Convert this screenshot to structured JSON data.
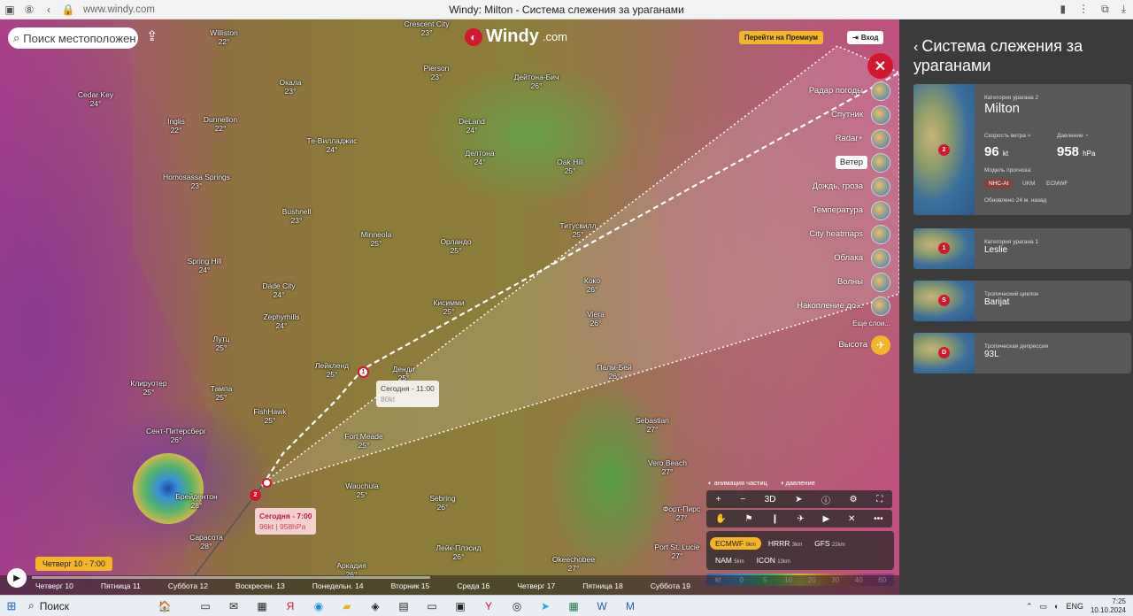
{
  "browser": {
    "url": "www.windy.com",
    "title": "Windy: Milton - Система слежения за ураганами"
  },
  "map": {
    "search_placeholder": "Поиск местоположен",
    "logo": "Windy",
    "logo_tld": ".com",
    "premium_label": "Перейти на Премиум",
    "login_label": "Вход",
    "cities": [
      {
        "name": "Williston",
        "temp": "22°"
      },
      {
        "name": "Crescent City",
        "temp": "23°"
      },
      {
        "name": "Cedar Key",
        "temp": "24°"
      },
      {
        "name": "Окала",
        "temp": "23°"
      },
      {
        "name": "Pierson",
        "temp": "23°"
      },
      {
        "name": "Дейтона-Бич",
        "temp": "26°"
      },
      {
        "name": "Inglis",
        "temp": "22°"
      },
      {
        "name": "Dunnellon",
        "temp": "22°"
      },
      {
        "name": "DeLand",
        "temp": "24°"
      },
      {
        "name": "Те-Вилладжис",
        "temp": "24°"
      },
      {
        "name": "Делтона",
        "temp": "24°"
      },
      {
        "name": "Oak Hill",
        "temp": "25°"
      },
      {
        "name": "Homosassa Springs",
        "temp": "23°"
      },
      {
        "name": "Bushnell",
        "temp": "23°"
      },
      {
        "name": "Титусвилл",
        "temp": "25°"
      },
      {
        "name": "Minneola",
        "temp": "25°"
      },
      {
        "name": "Орландо",
        "temp": "25°"
      },
      {
        "name": "Spring Hill",
        "temp": "24°"
      },
      {
        "name": "Dade City",
        "temp": "24°"
      },
      {
        "name": "Коко",
        "temp": "26°"
      },
      {
        "name": "Кисимми",
        "temp": "25°"
      },
      {
        "name": "Viera",
        "temp": "26°"
      },
      {
        "name": "Zephyrhills",
        "temp": "24°"
      },
      {
        "name": "Лутц",
        "temp": "25°"
      },
      {
        "name": "Лейкленд",
        "temp": "25°"
      },
      {
        "name": "Денди",
        "temp": "25°"
      },
      {
        "name": "Палм-Бей",
        "temp": "26°"
      },
      {
        "name": "Клируотер",
        "temp": "25°"
      },
      {
        "name": "Тампа",
        "temp": "25°"
      },
      {
        "name": "FishHawk",
        "temp": "25°"
      },
      {
        "name": "Sebastian",
        "temp": "27°"
      },
      {
        "name": "Сент-Питерсберг",
        "temp": "26°"
      },
      {
        "name": "Fort Meade",
        "temp": "25°"
      },
      {
        "name": "Vero Beach",
        "temp": "27°"
      },
      {
        "name": "Брейдентон",
        "temp": "28°"
      },
      {
        "name": "Wauchula",
        "temp": "25°"
      },
      {
        "name": "Sebring",
        "temp": "26°"
      },
      {
        "name": "Форт-Пирс",
        "temp": "27°"
      },
      {
        "name": "Сарасота",
        "temp": "28°"
      },
      {
        "name": "Лейк-Плэсид",
        "temp": "26°"
      },
      {
        "name": "Port St. Lucie",
        "temp": "27°"
      },
      {
        "name": "Аркадия",
        "temp": "26°"
      },
      {
        "name": "Okeechobee",
        "temp": "27°"
      }
    ],
    "forecast_point": {
      "time": "Сегодня - 11:00",
      "value": "80kt",
      "pin": "1"
    },
    "current_point": {
      "time": "Сегодня - 7:00",
      "value": "96kt | 958hPa",
      "pin": "2"
    },
    "layers": [
      {
        "label": "Радар погоды",
        "icon": "radar-icon"
      },
      {
        "label": "Спутник",
        "icon": "satellite-icon"
      },
      {
        "label": "Radar+",
        "icon": "radar-plus-icon"
      },
      {
        "label": "Ветер",
        "icon": "wind-icon",
        "active": true
      },
      {
        "label": "Дождь, гроза",
        "icon": "rain-icon"
      },
      {
        "label": "Температура",
        "icon": "temperature-icon"
      },
      {
        "label": "City heatmaps",
        "icon": "heatmap-icon"
      },
      {
        "label": "Облака",
        "icon": "clouds-icon"
      },
      {
        "label": "Волны",
        "icon": "waves-icon"
      },
      {
        "label": "Накопление до...",
        "icon": "accumulation-icon"
      }
    ],
    "more_layers": "Еще слои...",
    "altitude_label": "Высота",
    "toggle_particles": "анимация частиц",
    "toggle_pressure": "давление",
    "tool_3d": "3D",
    "models": [
      {
        "name": "ECMWF",
        "res": "9km",
        "active": true
      },
      {
        "name": "HRRR",
        "res": "3km"
      },
      {
        "name": "GFS",
        "res": "22km"
      },
      {
        "name": "NAM",
        "res": "5km"
      },
      {
        "name": "ICON",
        "res": "13km"
      }
    ],
    "scale": [
      "kt",
      "0",
      "5",
      "10",
      "20",
      "30",
      "40",
      "60"
    ],
    "current_time": "Четверг 10 - 7:00",
    "days": [
      "Четверг 10",
      "Пятница 11",
      "Суббота 12",
      "Воскресен. 13",
      "Понедельн. 14",
      "Вторник 15",
      "Среда 16",
      "Четверг 17",
      "Пятница 18",
      "Суббота 19"
    ]
  },
  "panel": {
    "title": "Система слежения за ураганами",
    "main_card": {
      "category": "Категория урагана 2",
      "name": "Milton",
      "wind_label": "Скорость ветра",
      "wind_value": "96",
      "wind_unit": "kt",
      "pressure_label": "Давление",
      "pressure_value": "958",
      "pressure_unit": "hPa",
      "model_label": "Модель прогноза:",
      "models": [
        "NHC-At",
        "UKM",
        "ECMWF"
      ],
      "updated": "Обновлено 24 м. назад",
      "pin": "2"
    },
    "cards": [
      {
        "category": "Категория урагана 1",
        "name": "Leslie",
        "pin": "1"
      },
      {
        "category": "Тропический циклон",
        "name": "Barijat",
        "pin": "S"
      },
      {
        "category": "Тропическая депрессия",
        "name": "93L",
        "pin": "D"
      }
    ]
  },
  "taskbar": {
    "search": "Поиск",
    "lang": "ENG",
    "time": "7:25",
    "date": "10.10.2024"
  }
}
